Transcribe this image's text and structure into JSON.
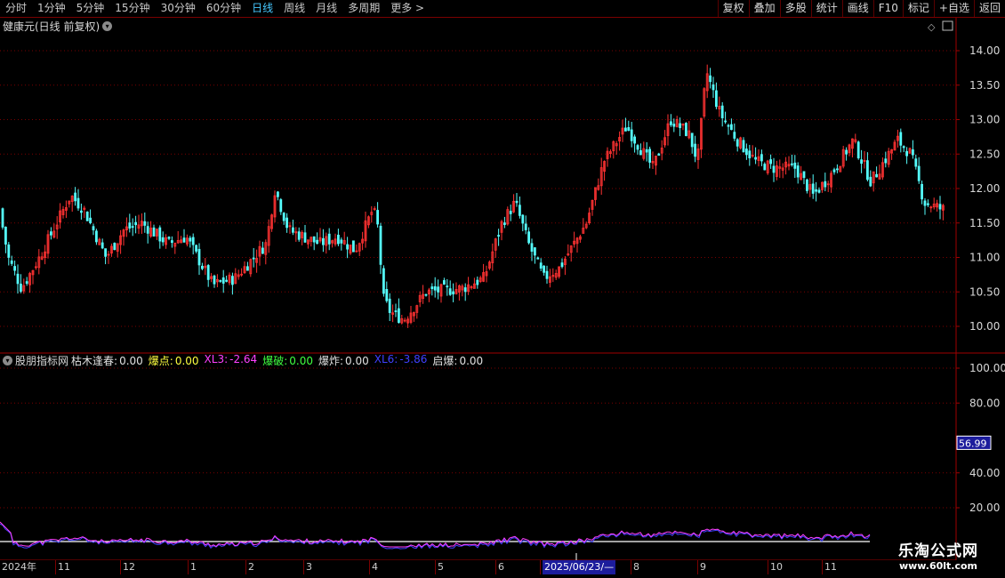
{
  "toolbar": {
    "periods": [
      "分时",
      "1分钟",
      "5分钟",
      "15分钟",
      "30分钟",
      "60分钟",
      "日线",
      "周线",
      "月线",
      "多周期",
      "更多 >"
    ],
    "active": "日线",
    "buttons": [
      "复权",
      "叠加",
      "多股",
      "统计",
      "画线",
      "F10",
      "标记",
      "+自选",
      "返回"
    ]
  },
  "main_chart": {
    "title": "健康元(日线 前复权)",
    "y_ticks": [
      "14.00",
      "13.50",
      "13.00",
      "12.50",
      "12.00",
      "11.50",
      "11.00",
      "10.50",
      "10.00"
    ]
  },
  "indicator": {
    "name": "股朋指标网",
    "items": [
      {
        "label": "枯木逢春:",
        "value": "0.00",
        "color": "#e0e0e0"
      },
      {
        "label": "爆点:",
        "value": "0.00",
        "color": "#ffff40"
      },
      {
        "label": "XL3:",
        "value": "-2.64",
        "color": "#ff40ff"
      },
      {
        "label": "爆破:",
        "value": "0.00",
        "color": "#40ff40"
      },
      {
        "label": "爆炸:",
        "value": "0.00",
        "color": "#e0e0e0"
      },
      {
        "label": "XL6:",
        "value": "-3.86",
        "color": "#4040ff"
      },
      {
        "label": "启爆:",
        "value": "0.00",
        "color": "#e0e0e0"
      }
    ],
    "y_ticks": [
      "100.00",
      "80.00",
      "40.00",
      "20.00"
    ],
    "current_value": "56.99"
  },
  "x_axis": {
    "labels": [
      "2024年",
      "11",
      "12",
      "1",
      "2",
      "3",
      "4",
      "5",
      "6",
      "2025/06/23/—",
      "8",
      "9",
      "10",
      "11"
    ]
  },
  "watermark": {
    "line1": "乐淘公式网",
    "line2": "www.60lt.com"
  },
  "colors": {
    "up": "#ff3232",
    "down": "#54fcfc",
    "grid": "#7a0000",
    "axis_border": "#a00000"
  }
}
